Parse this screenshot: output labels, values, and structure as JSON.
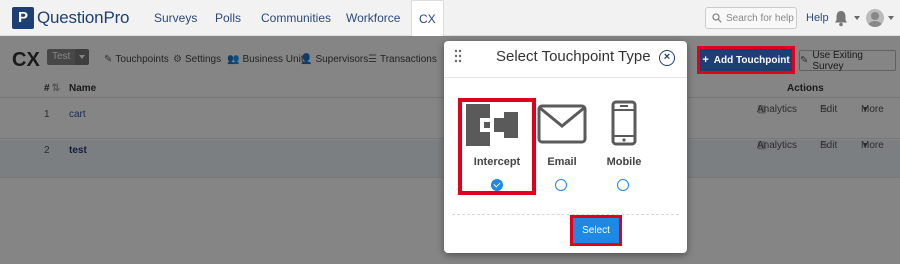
{
  "app": {
    "logo_letter": "P",
    "logo_text": "QuestionPro",
    "nav": [
      "Surveys",
      "Polls",
      "Communities",
      "Workforce",
      "CX"
    ],
    "search_placeholder": "Search for help",
    "help": "Help"
  },
  "page": {
    "title": "CX",
    "selector": "Test",
    "submenu": [
      "Touchpoints",
      "Settings",
      "Business Unit",
      "Supervisors",
      "Transactions"
    ],
    "add_touchpoint": "Add Touchpoint",
    "use_existing": "Use Exiting Survey"
  },
  "table": {
    "headers": {
      "num": "#",
      "name": "Name",
      "actions": "Actions"
    },
    "rows": [
      {
        "num": "1",
        "name": "cart",
        "analytics": "Analytics",
        "edit": "Edit",
        "more": "More"
      },
      {
        "num": "2",
        "name": "test",
        "analytics": "Analytics",
        "edit": "Edit",
        "more": "More"
      }
    ]
  },
  "modal": {
    "title": "Select Touchpoint Type",
    "close": "×",
    "options": [
      {
        "label": "Intercept",
        "icon": "intercept-icon",
        "selected": true
      },
      {
        "label": "Email",
        "icon": "envelope-icon",
        "selected": false
      },
      {
        "label": "Mobile",
        "icon": "mobile-phone-icon",
        "selected": false
      }
    ],
    "select_button": "Select"
  },
  "colors": {
    "brand": "#1d3f74",
    "accent": "#1e88e5",
    "highlight": "#e0001b"
  }
}
